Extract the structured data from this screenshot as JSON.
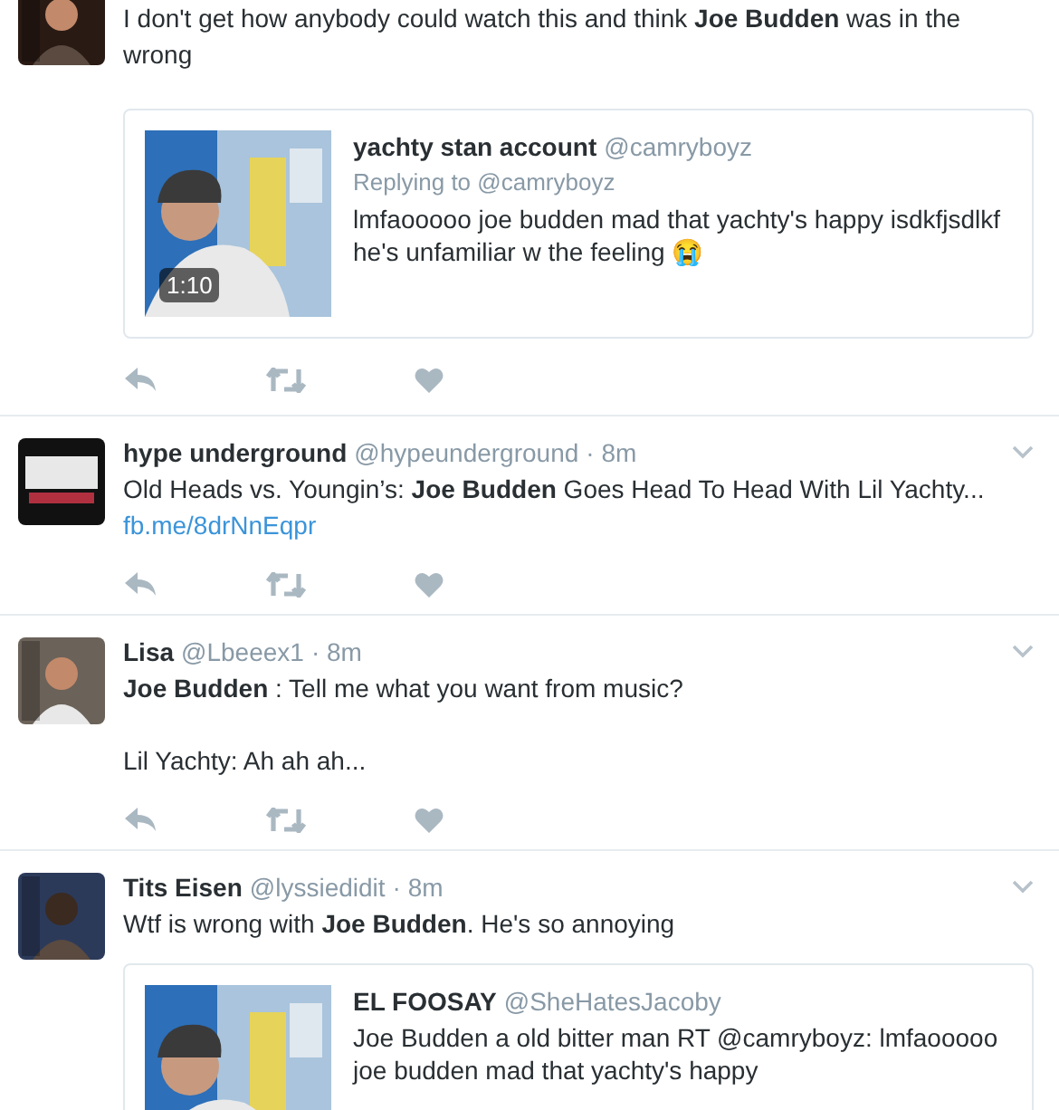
{
  "tweets": [
    {
      "text": "I don't get how anybody could watch this and think **Joe Budden** was in the wrong",
      "quote": {
        "name": "yachty stan account",
        "handle": "@camryboyz",
        "replying": "Replying to @camryboyz",
        "text": "lmfaooooo joe budden mad that yachty's happy isdkfjsdlkf he's unfamiliar w the feeling 😭",
        "duration": "1:10"
      },
      "actions": true
    },
    {
      "name": "hype underground",
      "handle": "@hypeunderground",
      "time": "· 8m",
      "text": "Old Heads vs. Youngin’s: **Joe Budden** Goes Head To Head With Lil Yachty...",
      "link": "fb.me/8drNnEqpr",
      "actions": true
    },
    {
      "name": "Lisa",
      "handle": "@Lbeeex1",
      "time": "· 8m",
      "text": "**Joe Budden** : Tell me what you want from music?\n\nLil Yachty: Ah ah ah...",
      "actions": true
    },
    {
      "name": "Tits Eisen",
      "handle": "@lyssiedidit",
      "time": "· 8m",
      "text": "Wtf is wrong with **Joe Budden**. He's so annoying",
      "quote": {
        "name": "EL FOOSAY",
        "handle": "@SheHatesJacoby",
        "text": "Joe Budden a old bitter man RT @camryboyz: lmfaooooo joe budden mad that yachty's happy"
      },
      "actions": false
    }
  ]
}
